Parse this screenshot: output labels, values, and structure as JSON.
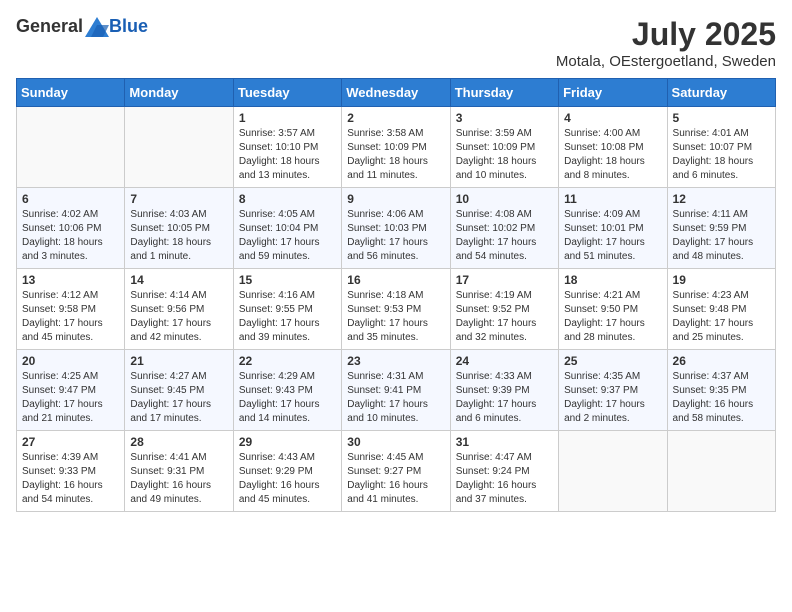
{
  "header": {
    "logo_general": "General",
    "logo_blue": "Blue",
    "month": "July 2025",
    "location": "Motala, OEstergoetland, Sweden"
  },
  "weekdays": [
    "Sunday",
    "Monday",
    "Tuesday",
    "Wednesday",
    "Thursday",
    "Friday",
    "Saturday"
  ],
  "weeks": [
    [
      {
        "day": "",
        "info": ""
      },
      {
        "day": "",
        "info": ""
      },
      {
        "day": "1",
        "info": "Sunrise: 3:57 AM\nSunset: 10:10 PM\nDaylight: 18 hours and 13 minutes."
      },
      {
        "day": "2",
        "info": "Sunrise: 3:58 AM\nSunset: 10:09 PM\nDaylight: 18 hours and 11 minutes."
      },
      {
        "day": "3",
        "info": "Sunrise: 3:59 AM\nSunset: 10:09 PM\nDaylight: 18 hours and 10 minutes."
      },
      {
        "day": "4",
        "info": "Sunrise: 4:00 AM\nSunset: 10:08 PM\nDaylight: 18 hours and 8 minutes."
      },
      {
        "day": "5",
        "info": "Sunrise: 4:01 AM\nSunset: 10:07 PM\nDaylight: 18 hours and 6 minutes."
      }
    ],
    [
      {
        "day": "6",
        "info": "Sunrise: 4:02 AM\nSunset: 10:06 PM\nDaylight: 18 hours and 3 minutes."
      },
      {
        "day": "7",
        "info": "Sunrise: 4:03 AM\nSunset: 10:05 PM\nDaylight: 18 hours and 1 minute."
      },
      {
        "day": "8",
        "info": "Sunrise: 4:05 AM\nSunset: 10:04 PM\nDaylight: 17 hours and 59 minutes."
      },
      {
        "day": "9",
        "info": "Sunrise: 4:06 AM\nSunset: 10:03 PM\nDaylight: 17 hours and 56 minutes."
      },
      {
        "day": "10",
        "info": "Sunrise: 4:08 AM\nSunset: 10:02 PM\nDaylight: 17 hours and 54 minutes."
      },
      {
        "day": "11",
        "info": "Sunrise: 4:09 AM\nSunset: 10:01 PM\nDaylight: 17 hours and 51 minutes."
      },
      {
        "day": "12",
        "info": "Sunrise: 4:11 AM\nSunset: 9:59 PM\nDaylight: 17 hours and 48 minutes."
      }
    ],
    [
      {
        "day": "13",
        "info": "Sunrise: 4:12 AM\nSunset: 9:58 PM\nDaylight: 17 hours and 45 minutes."
      },
      {
        "day": "14",
        "info": "Sunrise: 4:14 AM\nSunset: 9:56 PM\nDaylight: 17 hours and 42 minutes."
      },
      {
        "day": "15",
        "info": "Sunrise: 4:16 AM\nSunset: 9:55 PM\nDaylight: 17 hours and 39 minutes."
      },
      {
        "day": "16",
        "info": "Sunrise: 4:18 AM\nSunset: 9:53 PM\nDaylight: 17 hours and 35 minutes."
      },
      {
        "day": "17",
        "info": "Sunrise: 4:19 AM\nSunset: 9:52 PM\nDaylight: 17 hours and 32 minutes."
      },
      {
        "day": "18",
        "info": "Sunrise: 4:21 AM\nSunset: 9:50 PM\nDaylight: 17 hours and 28 minutes."
      },
      {
        "day": "19",
        "info": "Sunrise: 4:23 AM\nSunset: 9:48 PM\nDaylight: 17 hours and 25 minutes."
      }
    ],
    [
      {
        "day": "20",
        "info": "Sunrise: 4:25 AM\nSunset: 9:47 PM\nDaylight: 17 hours and 21 minutes."
      },
      {
        "day": "21",
        "info": "Sunrise: 4:27 AM\nSunset: 9:45 PM\nDaylight: 17 hours and 17 minutes."
      },
      {
        "day": "22",
        "info": "Sunrise: 4:29 AM\nSunset: 9:43 PM\nDaylight: 17 hours and 14 minutes."
      },
      {
        "day": "23",
        "info": "Sunrise: 4:31 AM\nSunset: 9:41 PM\nDaylight: 17 hours and 10 minutes."
      },
      {
        "day": "24",
        "info": "Sunrise: 4:33 AM\nSunset: 9:39 PM\nDaylight: 17 hours and 6 minutes."
      },
      {
        "day": "25",
        "info": "Sunrise: 4:35 AM\nSunset: 9:37 PM\nDaylight: 17 hours and 2 minutes."
      },
      {
        "day": "26",
        "info": "Sunrise: 4:37 AM\nSunset: 9:35 PM\nDaylight: 16 hours and 58 minutes."
      }
    ],
    [
      {
        "day": "27",
        "info": "Sunrise: 4:39 AM\nSunset: 9:33 PM\nDaylight: 16 hours and 54 minutes."
      },
      {
        "day": "28",
        "info": "Sunrise: 4:41 AM\nSunset: 9:31 PM\nDaylight: 16 hours and 49 minutes."
      },
      {
        "day": "29",
        "info": "Sunrise: 4:43 AM\nSunset: 9:29 PM\nDaylight: 16 hours and 45 minutes."
      },
      {
        "day": "30",
        "info": "Sunrise: 4:45 AM\nSunset: 9:27 PM\nDaylight: 16 hours and 41 minutes."
      },
      {
        "day": "31",
        "info": "Sunrise: 4:47 AM\nSunset: 9:24 PM\nDaylight: 16 hours and 37 minutes."
      },
      {
        "day": "",
        "info": ""
      },
      {
        "day": "",
        "info": ""
      }
    ]
  ]
}
